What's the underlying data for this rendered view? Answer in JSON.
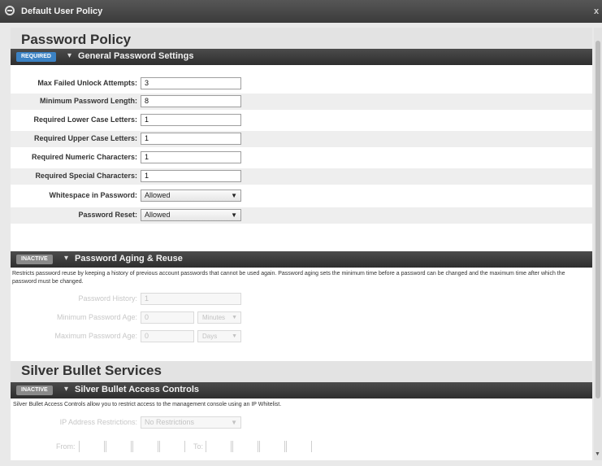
{
  "window": {
    "title": "Default User Policy",
    "close_label": "x"
  },
  "password_policy": {
    "heading": "Password Policy",
    "general": {
      "badge": "REQUIRED",
      "title": "General Password Settings",
      "fields": [
        {
          "label": "Max Failed Unlock Attempts:",
          "value": "3"
        },
        {
          "label": "Minimum Password Length:",
          "value": "8"
        },
        {
          "label": "Required Lower Case Letters:",
          "value": "1"
        },
        {
          "label": "Required Upper Case Letters:",
          "value": "1"
        },
        {
          "label": "Required Numeric Characters:",
          "value": "1"
        },
        {
          "label": "Required Special Characters:",
          "value": "1"
        }
      ],
      "selects": [
        {
          "label": "Whitespace in Password:",
          "value": "Allowed"
        },
        {
          "label": "Password Reset:",
          "value": "Allowed"
        }
      ]
    },
    "aging": {
      "badge": "INACTIVE",
      "title": "Password Aging & Reuse",
      "description": "Restricts password reuse by keeping a history of previous account passwords that cannot be used again. Password aging sets the minimum time before a password can be changed and the maximum time after which the password must be changed.",
      "history_label": "Password History:",
      "history_value": "1",
      "min_age_label": "Minimum Password Age:",
      "min_age_value": "0",
      "min_age_unit": "Minutes",
      "max_age_label": "Maximum Password Age:",
      "max_age_value": "0",
      "max_age_unit": "Days"
    }
  },
  "silver_bullet": {
    "heading": "Silver Bullet Services",
    "access": {
      "badge": "INACTIVE",
      "title": "Silver Bullet Access Controls",
      "description": "Silver Bullet Access Controls allow you to restrict access to the management console using an IP Whitelist.",
      "ip_label": "IP Address Restrictions:",
      "ip_value": "No Restrictions",
      "from_label": "From:",
      "to_label": "To:"
    }
  },
  "icons": {
    "chevron": "chevron-down-icon",
    "dropdown": "dropdown-arrow-icon",
    "logo": "app-logo-icon"
  }
}
